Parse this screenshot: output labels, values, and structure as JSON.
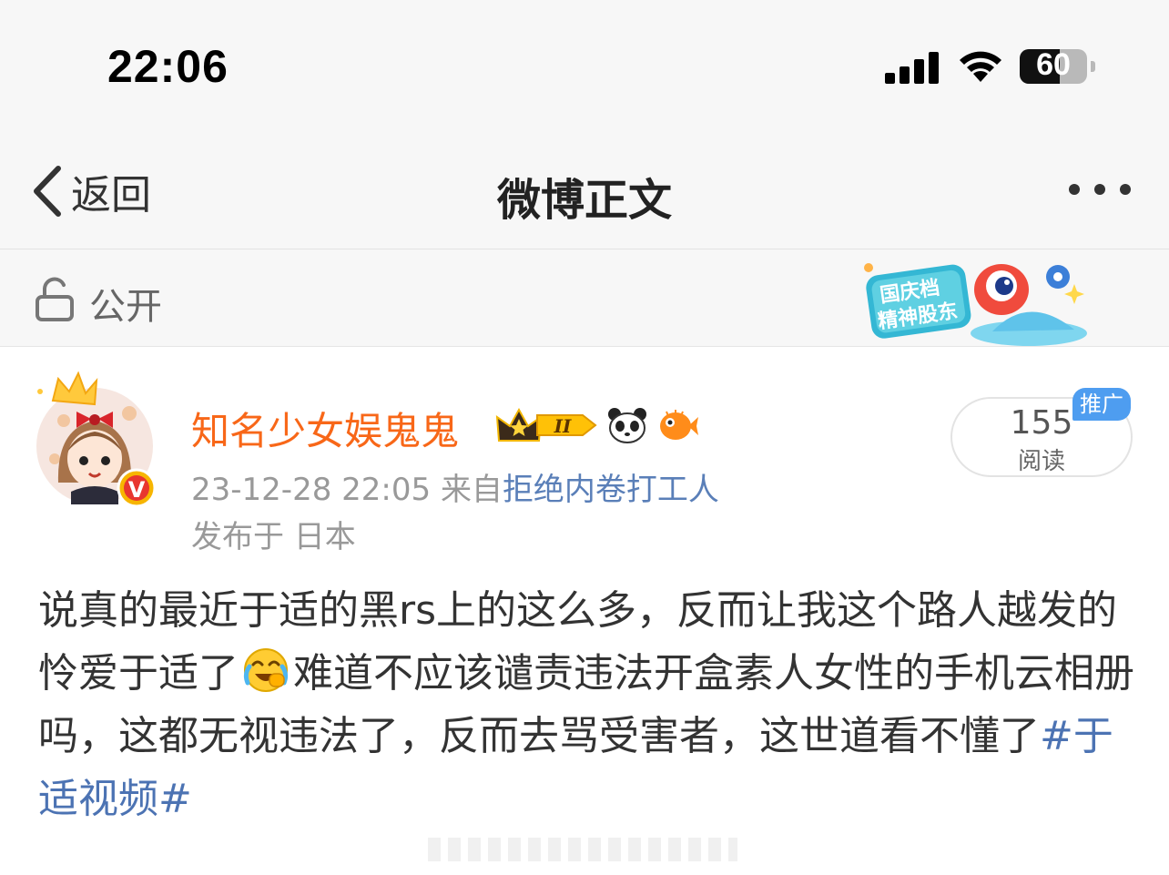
{
  "status_bar": {
    "time": "22:06",
    "battery": "60",
    "battery_level": 0.6
  },
  "nav": {
    "back_label": "返回",
    "title": "微博正文",
    "more_icon": "more-dots-icon"
  },
  "visibility": {
    "label": "公开",
    "icon": "lock-open-icon",
    "banner_text_1": "国庆档",
    "banner_text_2": "精神股东"
  },
  "post": {
    "author": "知名少女娱鬼鬼",
    "member_level": "II",
    "timestamp": "23-12-28 22:05",
    "source_prefix": "来自",
    "source": "拒绝内卷打工人",
    "location": "发布于 日本",
    "reads_count": "155",
    "reads_label": "阅读",
    "promo_badge": "推广",
    "text_part1": "说真的最近于适的黑rs上的这么多，反而让我这个路人越发的怜爱于适了",
    "text_part2": "难道不应该谴责违法开盒素人女性的手机云相册吗，这都无视违法了，反而去骂受害者，这世道看不懂了",
    "hashtag": "#于适视频#"
  },
  "colors": {
    "username": "#f86718",
    "link": "#4c73b3",
    "promo": "#4e9df0"
  }
}
